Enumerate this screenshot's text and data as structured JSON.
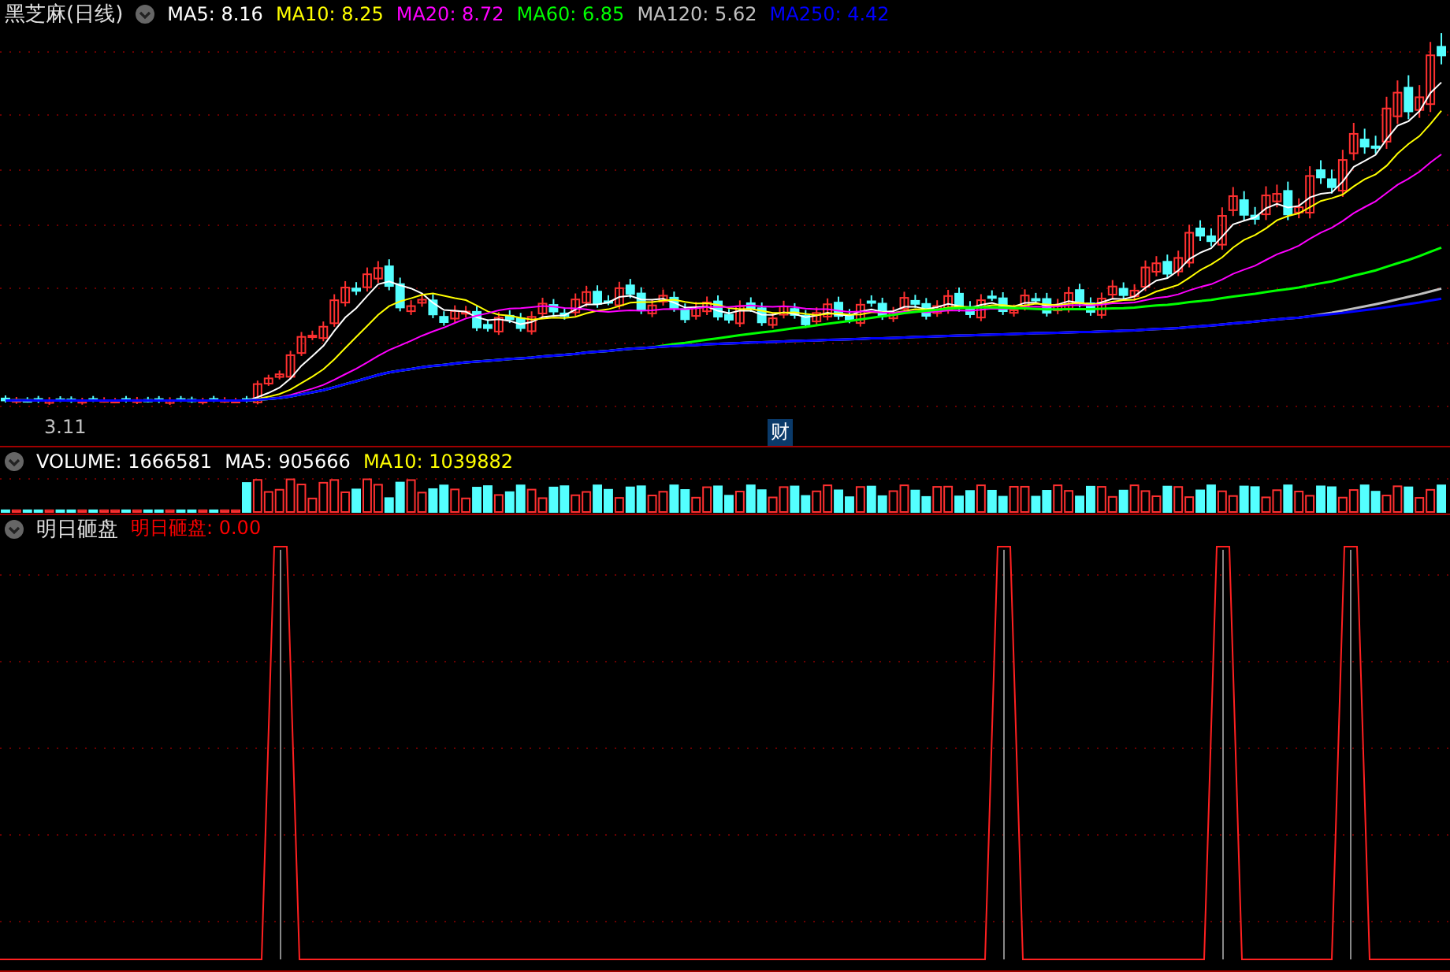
{
  "price_panel": {
    "title": "黑芝麻(日线)",
    "legend": [
      {
        "label": "MA5: 8.16",
        "color": "#ffffff"
      },
      {
        "label": "MA10: 8.25",
        "color": "#ffff00"
      },
      {
        "label": "MA20: 8.72",
        "color": "#ff00ff"
      },
      {
        "label": "MA60: 6.85",
        "color": "#00ff00"
      },
      {
        "label": "MA120: 5.62",
        "color": "#c0c0c0"
      },
      {
        "label": "MA250: 4.42",
        "color": "#0000ff"
      }
    ],
    "low_marker": "3.11",
    "badge": "财"
  },
  "volume_panel": {
    "legend": [
      {
        "label": "VOLUME: 1666581",
        "color": "#ffffff"
      },
      {
        "label": "MA5: 905666",
        "color": "#ffffff"
      },
      {
        "label": "MA10: 1039882",
        "color": "#ffff00"
      }
    ]
  },
  "indicator_panel": {
    "title": "明日砸盘",
    "legend": [
      {
        "label": "明日砸盘: 0.00",
        "color": "#ff0000"
      }
    ]
  }
}
